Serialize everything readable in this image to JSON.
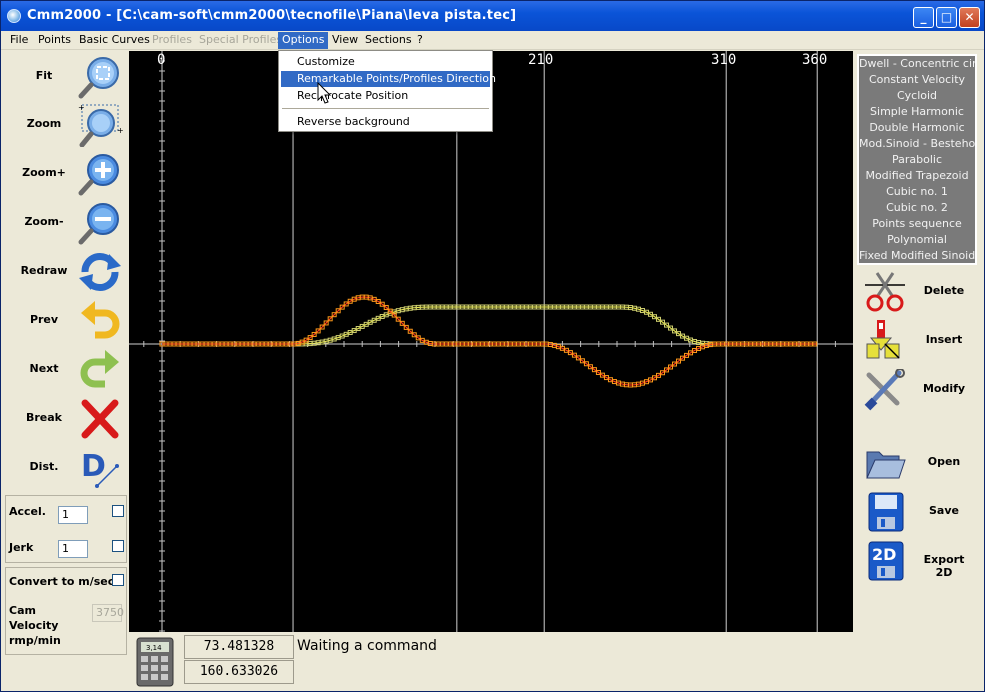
{
  "window": {
    "title": "Cmm2000 - [C:\\cam-soft\\cmm2000\\tecnofile\\Piana\\leva pista.tec]",
    "minimize": "_",
    "maximize": "□",
    "close": "✕"
  },
  "menu": [
    {
      "label": "File",
      "state": "normal"
    },
    {
      "label": "Points",
      "state": "normal"
    },
    {
      "label": "Basic Curves",
      "state": "normal"
    },
    {
      "label": "Profiles",
      "state": "disabled"
    },
    {
      "label": "Special Profiles",
      "state": "disabled"
    },
    {
      "label": "Options",
      "state": "active"
    },
    {
      "label": "View",
      "state": "normal"
    },
    {
      "label": "Sections",
      "state": "normal"
    },
    {
      "label": "?",
      "state": "normal"
    }
  ],
  "options_menu": {
    "items": [
      {
        "label": "Customize",
        "highlighted": false
      },
      {
        "label": "Remarkable Points/Profiles Direction",
        "highlighted": true
      },
      {
        "label": "Reciprocate Position",
        "highlighted": false
      },
      {
        "label": "Reverse background",
        "highlighted": false
      }
    ]
  },
  "left_tools": [
    {
      "label": "Fit",
      "icon": "fit-magnifier-icon"
    },
    {
      "label": "Zoom",
      "icon": "zoom-box-magnifier-icon"
    },
    {
      "label": "Zoom+",
      "icon": "zoom-in-icon"
    },
    {
      "label": "Zoom-",
      "icon": "zoom-out-icon"
    },
    {
      "label": "Redraw",
      "icon": "redraw-arrows-icon"
    },
    {
      "label": "Prev",
      "icon": "prev-arrow-icon"
    },
    {
      "label": "Next",
      "icon": "next-arrow-icon"
    },
    {
      "label": "Break",
      "icon": "break-x-icon"
    },
    {
      "label": "Dist.",
      "icon": "distance-icon"
    }
  ],
  "params": {
    "accel_label": "Accel.",
    "accel_value": "1",
    "jerk_label": "Jerk",
    "jerk_value": "1",
    "convert_label": "Convert to m/sec",
    "cam_velocity_label_1": "Cam",
    "cam_velocity_label_2": "Velocity",
    "cam_velocity_label_3": "rmp/min",
    "cam_velocity_value": "3750"
  },
  "plot": {
    "x_ticks": [
      "0",
      "210",
      "310",
      "360"
    ],
    "background": "#000000",
    "curve_red": "#ff3a1a",
    "curve_orange": "#ff9a1a",
    "curve_yellow": "#e6e64a"
  },
  "curve_types": [
    "Dwell - Concentric circle",
    "Constant Velocity",
    "Cycloid",
    "Simple Harmonic",
    "Double Harmonic",
    "Mod.Sinoid - Bestehorn",
    "Parabolic",
    "Modified Trapezoid",
    "Cubic no.  1",
    "Cubic no.  2",
    "Points sequence",
    "Polynomial",
    "Fixed Modified Sinoid"
  ],
  "right_tools": [
    {
      "label": "Delete",
      "icon": "scissors-icon"
    },
    {
      "label": "Insert",
      "icon": "insert-icon"
    },
    {
      "label": "Modify",
      "icon": "tools-icon"
    },
    {
      "label": "Open",
      "icon": "folder-open-icon"
    },
    {
      "label": "Save",
      "icon": "floppy-disk-icon"
    },
    {
      "label": "Export 2D",
      "icon": "export-2d-icon"
    }
  ],
  "status": {
    "calc_label": "3,14",
    "value_1": "73.481328",
    "value_2": "160.633026",
    "message": "Waiting a command"
  }
}
